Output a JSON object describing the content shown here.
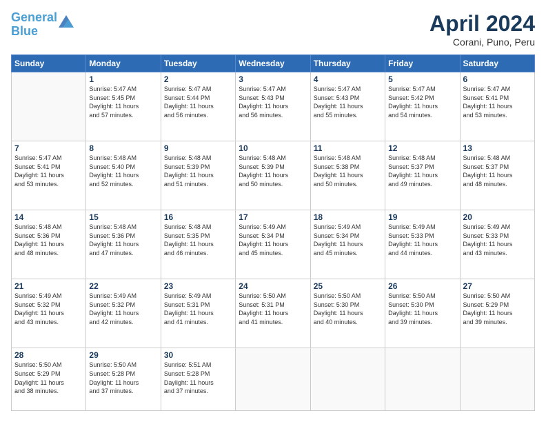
{
  "header": {
    "logo_line1": "General",
    "logo_line2": "Blue",
    "month": "April 2024",
    "location": "Corani, Puno, Peru"
  },
  "days_of_week": [
    "Sunday",
    "Monday",
    "Tuesday",
    "Wednesday",
    "Thursday",
    "Friday",
    "Saturday"
  ],
  "weeks": [
    [
      {
        "day": "",
        "info": ""
      },
      {
        "day": "1",
        "info": "Sunrise: 5:47 AM\nSunset: 5:45 PM\nDaylight: 11 hours\nand 57 minutes."
      },
      {
        "day": "2",
        "info": "Sunrise: 5:47 AM\nSunset: 5:44 PM\nDaylight: 11 hours\nand 56 minutes."
      },
      {
        "day": "3",
        "info": "Sunrise: 5:47 AM\nSunset: 5:43 PM\nDaylight: 11 hours\nand 56 minutes."
      },
      {
        "day": "4",
        "info": "Sunrise: 5:47 AM\nSunset: 5:43 PM\nDaylight: 11 hours\nand 55 minutes."
      },
      {
        "day": "5",
        "info": "Sunrise: 5:47 AM\nSunset: 5:42 PM\nDaylight: 11 hours\nand 54 minutes."
      },
      {
        "day": "6",
        "info": "Sunrise: 5:47 AM\nSunset: 5:41 PM\nDaylight: 11 hours\nand 53 minutes."
      }
    ],
    [
      {
        "day": "7",
        "info": "Sunrise: 5:47 AM\nSunset: 5:41 PM\nDaylight: 11 hours\nand 53 minutes."
      },
      {
        "day": "8",
        "info": "Sunrise: 5:48 AM\nSunset: 5:40 PM\nDaylight: 11 hours\nand 52 minutes."
      },
      {
        "day": "9",
        "info": "Sunrise: 5:48 AM\nSunset: 5:39 PM\nDaylight: 11 hours\nand 51 minutes."
      },
      {
        "day": "10",
        "info": "Sunrise: 5:48 AM\nSunset: 5:39 PM\nDaylight: 11 hours\nand 50 minutes."
      },
      {
        "day": "11",
        "info": "Sunrise: 5:48 AM\nSunset: 5:38 PM\nDaylight: 11 hours\nand 50 minutes."
      },
      {
        "day": "12",
        "info": "Sunrise: 5:48 AM\nSunset: 5:37 PM\nDaylight: 11 hours\nand 49 minutes."
      },
      {
        "day": "13",
        "info": "Sunrise: 5:48 AM\nSunset: 5:37 PM\nDaylight: 11 hours\nand 48 minutes."
      }
    ],
    [
      {
        "day": "14",
        "info": "Sunrise: 5:48 AM\nSunset: 5:36 PM\nDaylight: 11 hours\nand 48 minutes."
      },
      {
        "day": "15",
        "info": "Sunrise: 5:48 AM\nSunset: 5:36 PM\nDaylight: 11 hours\nand 47 minutes."
      },
      {
        "day": "16",
        "info": "Sunrise: 5:48 AM\nSunset: 5:35 PM\nDaylight: 11 hours\nand 46 minutes."
      },
      {
        "day": "17",
        "info": "Sunrise: 5:49 AM\nSunset: 5:34 PM\nDaylight: 11 hours\nand 45 minutes."
      },
      {
        "day": "18",
        "info": "Sunrise: 5:49 AM\nSunset: 5:34 PM\nDaylight: 11 hours\nand 45 minutes."
      },
      {
        "day": "19",
        "info": "Sunrise: 5:49 AM\nSunset: 5:33 PM\nDaylight: 11 hours\nand 44 minutes."
      },
      {
        "day": "20",
        "info": "Sunrise: 5:49 AM\nSunset: 5:33 PM\nDaylight: 11 hours\nand 43 minutes."
      }
    ],
    [
      {
        "day": "21",
        "info": "Sunrise: 5:49 AM\nSunset: 5:32 PM\nDaylight: 11 hours\nand 43 minutes."
      },
      {
        "day": "22",
        "info": "Sunrise: 5:49 AM\nSunset: 5:32 PM\nDaylight: 11 hours\nand 42 minutes."
      },
      {
        "day": "23",
        "info": "Sunrise: 5:49 AM\nSunset: 5:31 PM\nDaylight: 11 hours\nand 41 minutes."
      },
      {
        "day": "24",
        "info": "Sunrise: 5:50 AM\nSunset: 5:31 PM\nDaylight: 11 hours\nand 41 minutes."
      },
      {
        "day": "25",
        "info": "Sunrise: 5:50 AM\nSunset: 5:30 PM\nDaylight: 11 hours\nand 40 minutes."
      },
      {
        "day": "26",
        "info": "Sunrise: 5:50 AM\nSunset: 5:30 PM\nDaylight: 11 hours\nand 39 minutes."
      },
      {
        "day": "27",
        "info": "Sunrise: 5:50 AM\nSunset: 5:29 PM\nDaylight: 11 hours\nand 39 minutes."
      }
    ],
    [
      {
        "day": "28",
        "info": "Sunrise: 5:50 AM\nSunset: 5:29 PM\nDaylight: 11 hours\nand 38 minutes."
      },
      {
        "day": "29",
        "info": "Sunrise: 5:50 AM\nSunset: 5:28 PM\nDaylight: 11 hours\nand 37 minutes."
      },
      {
        "day": "30",
        "info": "Sunrise: 5:51 AM\nSunset: 5:28 PM\nDaylight: 11 hours\nand 37 minutes."
      },
      {
        "day": "",
        "info": ""
      },
      {
        "day": "",
        "info": ""
      },
      {
        "day": "",
        "info": ""
      },
      {
        "day": "",
        "info": ""
      }
    ]
  ]
}
